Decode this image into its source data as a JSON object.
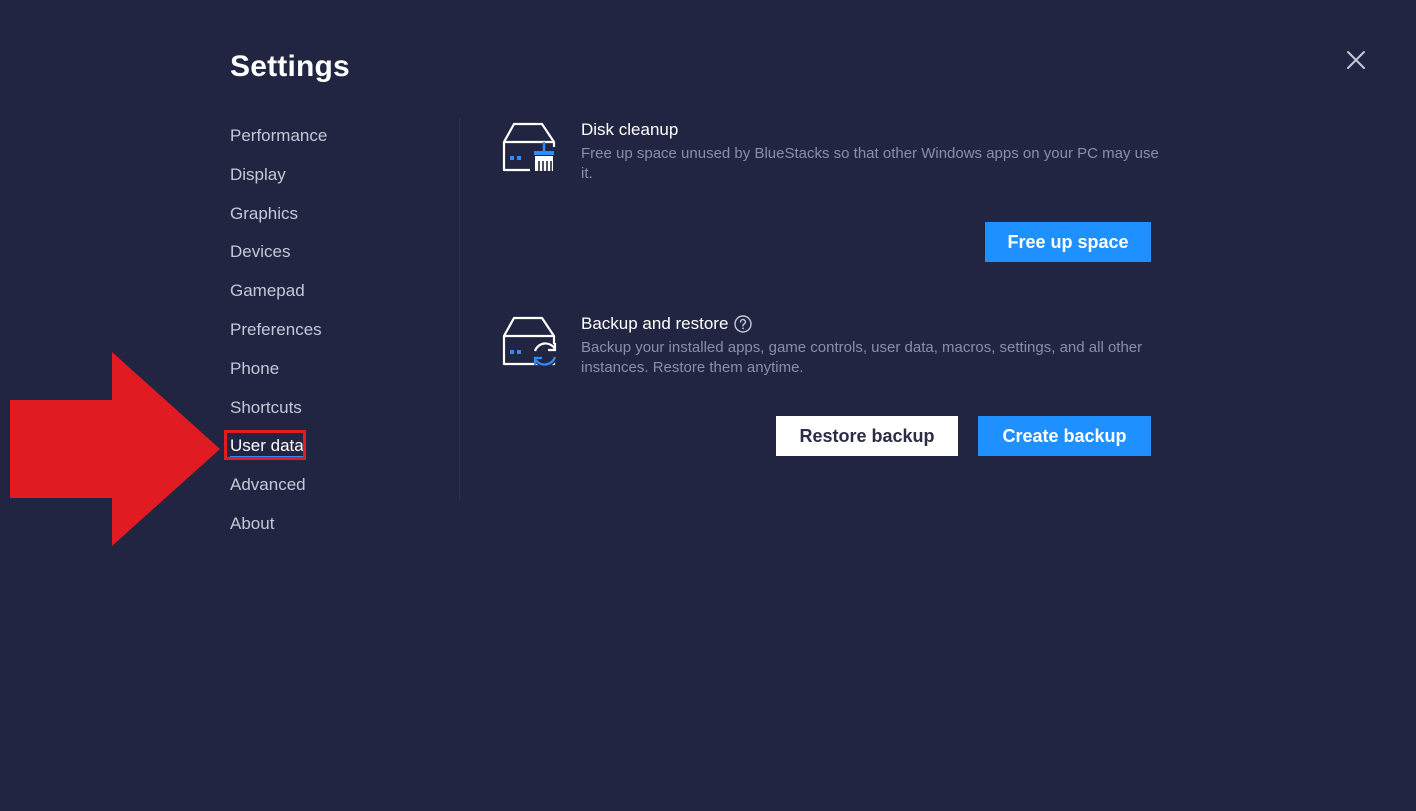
{
  "window": {
    "title": "Settings",
    "close_icon": "close-icon"
  },
  "sidebar": {
    "items": [
      {
        "label": "Performance"
      },
      {
        "label": "Display"
      },
      {
        "label": "Graphics"
      },
      {
        "label": "Devices"
      },
      {
        "label": "Gamepad"
      },
      {
        "label": "Preferences"
      },
      {
        "label": "Phone"
      },
      {
        "label": "Shortcuts"
      },
      {
        "label": "User data",
        "selected": true
      },
      {
        "label": "Advanced"
      },
      {
        "label": "About"
      }
    ]
  },
  "disk_cleanup": {
    "icon": "disk-cleanup-icon",
    "heading": "Disk cleanup",
    "description": "Free up space unused by BlueStacks so that other Windows apps on your PC may use it.",
    "button_label": "Free up space"
  },
  "backup": {
    "icon": "backup-restore-icon",
    "heading": "Backup and restore",
    "help_icon": "help-icon",
    "description": "Backup your installed apps, game controls, user data, macros, settings, and all other instances. Restore them anytime.",
    "restore_label": "Restore backup",
    "create_label": "Create backup"
  },
  "colors": {
    "background": "#222541",
    "accent": "#1e90ff",
    "highlight": "#e11b22"
  }
}
